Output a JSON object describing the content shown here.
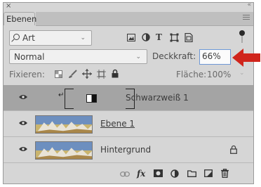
{
  "panel": {
    "close_glyph": "×",
    "collapse_glyph": "«",
    "tab_label": "Ebenen",
    "menu_icon": "panel-menu-icon"
  },
  "filter": {
    "kind_label": "Art",
    "kind_chevron": "⌄",
    "filter_icons": [
      "image-filter-icon",
      "adjustment-filter-icon",
      "type-filter-icon",
      "shape-filter-icon",
      "smartobject-filter-icon"
    ],
    "type_glyph": "T",
    "toggle": "filter-toggle"
  },
  "blend": {
    "mode": "Normal",
    "chevron": "⌄",
    "opacity_label": "Deckkraft:",
    "opacity_value": "66%"
  },
  "locks": {
    "label": "Fixieren:",
    "fill_label": "Fläche:",
    "fill_value": "100%",
    "fill_chevron": "⌄"
  },
  "layers": [
    {
      "name": "Schwarzweiß 1",
      "type": "adjustment",
      "selected": true,
      "visible": true
    },
    {
      "name": "Ebene 1",
      "type": "pixel",
      "selected": false,
      "visible": true
    },
    {
      "name": "Hintergrund",
      "type": "pixel",
      "selected": false,
      "visible": true,
      "locked": true
    }
  ],
  "bottom_bar": {
    "fx_label": "fx",
    "icons": [
      "link-layers-icon",
      "fx-icon",
      "mask-icon",
      "adjustment-icon",
      "group-icon",
      "new-layer-icon",
      "delete-icon"
    ]
  },
  "colors": {
    "panel_bg": "#d6d6d6",
    "selected_row": "#a4a4a4",
    "focus_border": "#6e98d6",
    "annotation_arrow": "#d0251c"
  }
}
